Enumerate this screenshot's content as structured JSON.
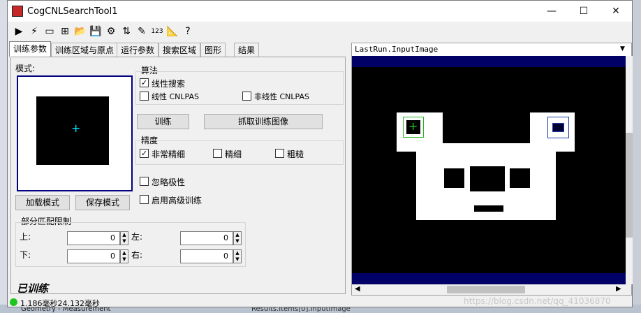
{
  "window": {
    "title": "CogCNLSearchTool1"
  },
  "title_buttons": {
    "minimize": "—",
    "maximize": "☐",
    "close": "✕"
  },
  "toolbar": [
    {
      "name": "run-icon",
      "glyph": "▶"
    },
    {
      "name": "electric-icon",
      "glyph": "⚡"
    },
    {
      "name": "display-icon",
      "glyph": "▭"
    },
    {
      "name": "add-icon",
      "glyph": "⊞"
    },
    {
      "name": "open-folder-icon",
      "glyph": "📂"
    },
    {
      "name": "save-icon",
      "glyph": "💾"
    },
    {
      "name": "properties-icon",
      "glyph": "⚙"
    },
    {
      "name": "import-icon",
      "glyph": "⇅"
    },
    {
      "name": "tool-icon",
      "glyph": "✎"
    },
    {
      "name": "number-icon",
      "glyph": "123"
    },
    {
      "name": "ruler-icon",
      "glyph": "📐"
    },
    {
      "name": "help-icon",
      "glyph": "?"
    }
  ],
  "tabs": [
    "训练参数",
    "训练区域与原点",
    "运行参数",
    "搜索区域",
    "图形",
    "结果"
  ],
  "train": {
    "pattern_label": "模式:",
    "load_button": "加载模式",
    "save_button": "保存模式",
    "algorithm": {
      "title": "算法",
      "opt1": "线性搜索",
      "opt2": "线性 CNLPAS",
      "opt3": "非线性 CNLPAS"
    },
    "train_button": "训练",
    "grab_button": "抓取训练图像",
    "precision": {
      "title": "精度",
      "opt1": "非常精细",
      "opt2": "精细",
      "opt3": "粗糙"
    },
    "ignore_polarity": "忽略极性",
    "advanced": "启用高级训练",
    "partial": {
      "title": "部分匹配限制",
      "top": "上:",
      "left": "左:",
      "bottom": "下:",
      "right": "右:",
      "top_val": "0",
      "left_val": "0",
      "bottom_val": "0",
      "right_val": "0"
    },
    "trained_status": "已训练"
  },
  "status": {
    "time": "1.186毫秒24.132毫秒"
  },
  "image": {
    "title": "LastRun.InputImage"
  },
  "background": {
    "bottom_left": "Geometry - Measurement",
    "bottom_mid": "Results.Items[0].InputImage",
    "watermark": "https://blog.csdn.net/qq_41036870"
  }
}
